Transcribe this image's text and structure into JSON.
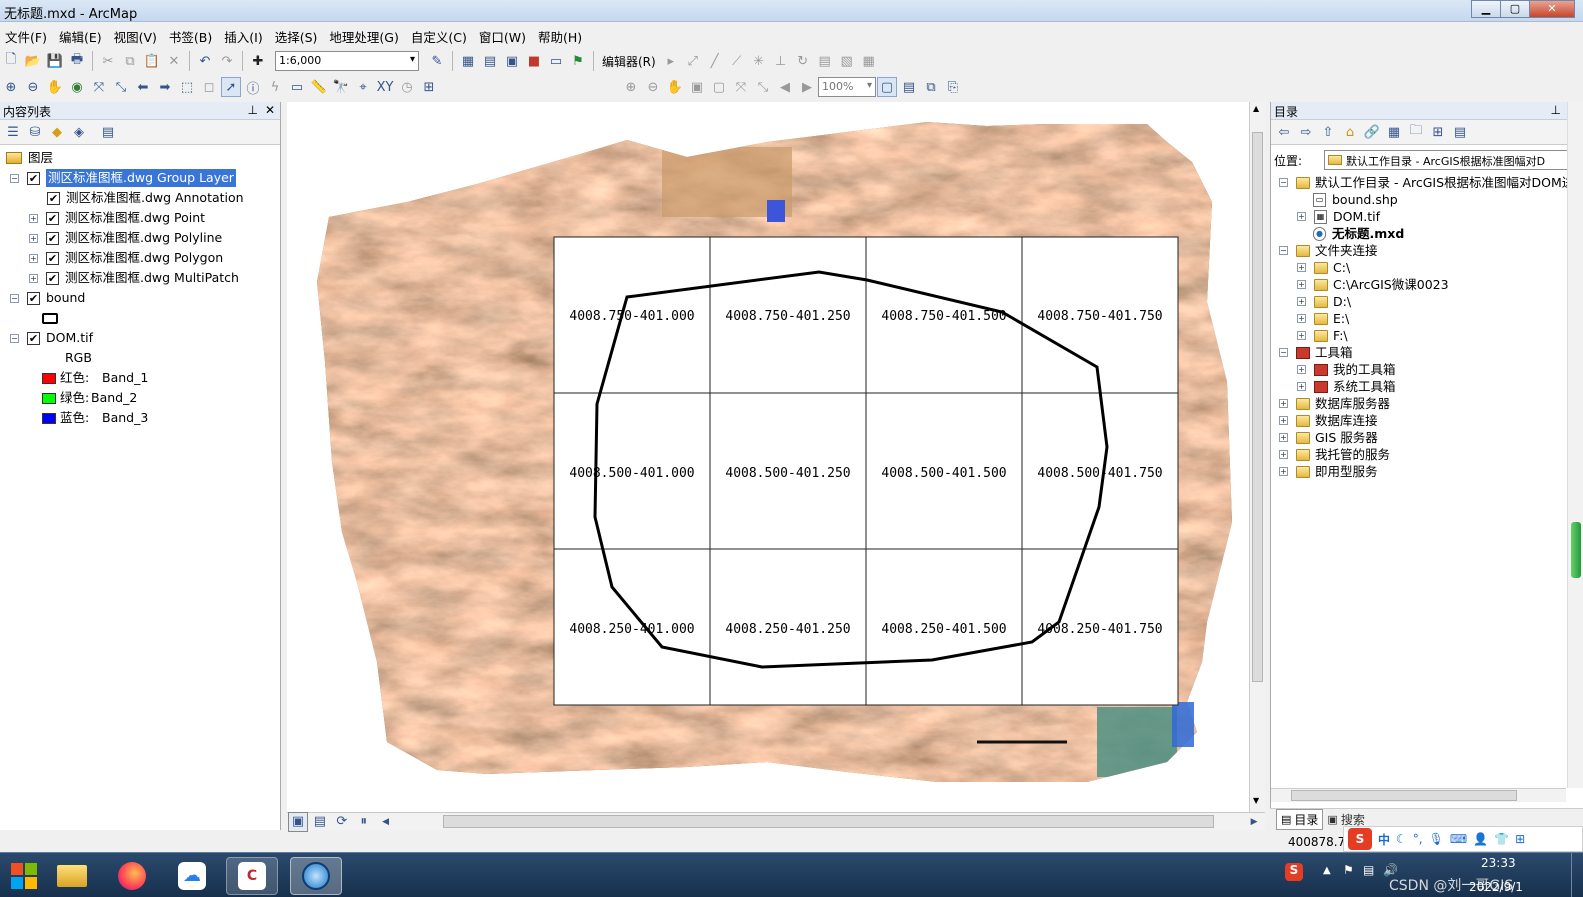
{
  "window": {
    "title": "无标题.mxd - ArcMap",
    "min": "▁",
    "max": "▢",
    "close": "✕"
  },
  "menu": [
    "文件(F)",
    "编辑(E)",
    "视图(V)",
    "书签(B)",
    "插入(I)",
    "选择(S)",
    "地理处理(G)",
    "自定义(C)",
    "窗口(W)",
    "帮助(H)"
  ],
  "toolbar": {
    "scale": "1:6,000",
    "editor": "编辑器(R)",
    "zoom": "100%"
  },
  "toc": {
    "title": "内容列表",
    "root": "图层",
    "group": "测区标准图框.dwg Group Layer",
    "sublayers": [
      "测区标准图框.dwg Annotation",
      "测区标准图框.dwg Point",
      "测区标准图框.dwg Polyline",
      "测区标准图框.dwg Polygon",
      "测区标准图框.dwg MultiPatch"
    ],
    "bound": "bound",
    "dom": "DOM.tif",
    "rgb": "RGB",
    "bands": [
      {
        "name": "红色:",
        "band": "Band_1",
        "color": "#ff0000"
      },
      {
        "name": "绿色:",
        "band": "Band_2",
        "color": "#00ff00"
      },
      {
        "name": "蓝色:",
        "band": "Band_3",
        "color": "#0000ff"
      }
    ]
  },
  "map": {
    "labels": [
      [
        "4008.750-401.000",
        "4008.750-401.250",
        "4008.750-401.500",
        "4008.750-401.750"
      ],
      [
        "4008.500-401.000",
        "4008.500-401.250",
        "4008.500-401.500",
        "4008.500-401.750"
      ],
      [
        "4008.250-401.000",
        "4008.250-401.250",
        "4008.250-401.500",
        "4008.250-401.750"
      ]
    ]
  },
  "catalog": {
    "title": "目录",
    "location_label": "位置:",
    "location_value": "默认工作目录 - ArcGIS根据标准图幅对D",
    "items": {
      "home": "默认工作目录 - ArcGIS根据标准图幅对DOM进",
      "bound_shp": "bound.shp",
      "dom_tif": "DOM.tif",
      "mxd": "无标题.mxd",
      "folders": "文件夹连接",
      "c": "C:\\",
      "c2": "C:\\ArcGIS微课0023",
      "d": "D:\\",
      "e": "E:\\",
      "f": "F:\\",
      "toolboxes": "工具箱",
      "my_tb": "我的工具箱",
      "sys_tb": "系统工具箱",
      "db_servers": "数据库服务器",
      "db_conn": "数据库连接",
      "gis_servers": "GIS 服务器",
      "hosted": "我托管的服务",
      "ready": "即用型服务"
    },
    "tabs": [
      "目录",
      "搜索"
    ]
  },
  "status": {
    "coord": "400878.72"
  },
  "taskbar": {
    "time": "23:33",
    "date": "2022/9/1",
    "watermark": "CSDN @刘一哥GIS",
    "ime": "中"
  }
}
